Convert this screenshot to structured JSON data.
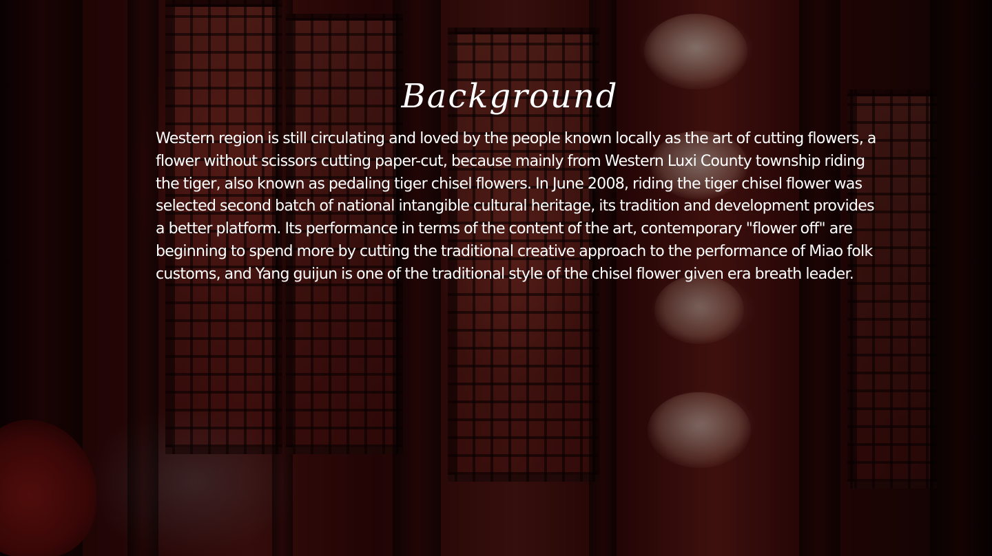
{
  "slide": {
    "title": "Background",
    "paragraph": "Western region is still circulating and loved by the people known locally as the art of cutting flowers, a flower without scissors cutting paper-cut, because mainly from Western Luxi County township riding the tiger, also known as pedaling tiger chisel flowers. In June 2008, riding the tiger chisel flower was selected second batch of national intangible cultural heritage, its tradition and development provides a better platform. Its performance in terms of the content of the art, contemporary \"flower off\" are beginning to spend more by cutting the traditional creative approach to the performance of Miao folk customs, and Yang guijun is one of the traditional style of the chisel flower given era breath leader."
  },
  "colors": {
    "text": "#ffffff",
    "background_dark": "#1a0506",
    "accent_red": "#6b1d18"
  }
}
